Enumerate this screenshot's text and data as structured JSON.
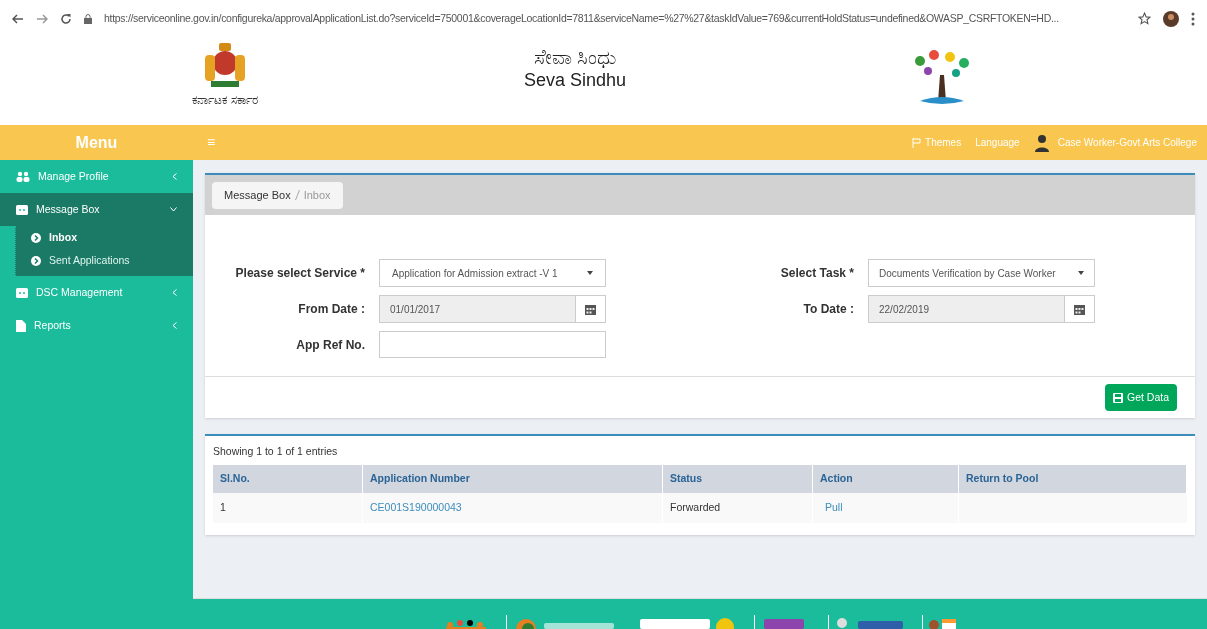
{
  "browser": {
    "url": "https://serviceonline.gov.in/configureka/approvalApplicationList.do?serviceId=750001&coverageLocationId=7811&serviceName=%27%27&taskIdValue=769&currentHoldStatus=undefined&OWASP_CSRFTOKEN=HD..."
  },
  "header": {
    "emblem_caption": "ಕರ್ನಾಟಕ ಸರ್ಕಾರ",
    "title_kannada": "ಸೇವಾ ಸಿಂಧು",
    "title": "Seva Sindhu"
  },
  "topbar": {
    "menu_label": "Menu",
    "menu_toggle": "≡",
    "themes": "Themes",
    "language": "Language",
    "user": "Case Worker-Govt Arts College"
  },
  "sidebar": {
    "items": [
      {
        "label": "Manage Profile",
        "expanded": false
      },
      {
        "label": "Message Box",
        "expanded": true,
        "children": [
          {
            "label": "Inbox",
            "selected": true
          },
          {
            "label": "Sent Applications",
            "selected": false
          }
        ]
      },
      {
        "label": "DSC Management",
        "expanded": false
      },
      {
        "label": "Reports",
        "expanded": false
      }
    ]
  },
  "breadcrumb": [
    "Message Box",
    "Inbox"
  ],
  "form": {
    "service_label": "Please select Service *",
    "service_value": "Application for Admission extract -V 1",
    "task_label": "Select Task *",
    "task_value": "Documents Verification by Case Worker",
    "from_label": "From Date :",
    "from_value": "01/01/2017",
    "to_label": "To Date :",
    "to_value": "22/02/2019",
    "ref_label": "App Ref No.",
    "button": "Get Data"
  },
  "table": {
    "info": "Showing 1 to 1 of 1 entries",
    "columns": [
      "Sl.No.",
      "Application Number",
      "Status",
      "Action",
      "Return to Pool"
    ],
    "rows": [
      {
        "sl": "1",
        "app": "CE001S190000043",
        "status": "Forwarded",
        "action": "Pull"
      }
    ]
  }
}
